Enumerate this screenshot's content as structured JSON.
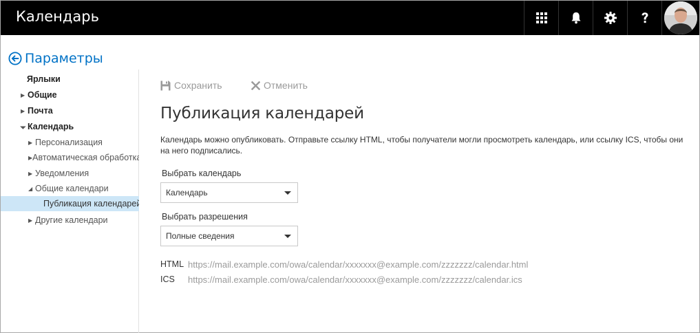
{
  "app": {
    "title": "Календарь"
  },
  "header": {
    "back_title": "Параметры"
  },
  "sidebar": {
    "items": [
      {
        "label": "Ярлыки",
        "level": 1,
        "caret": ""
      },
      {
        "label": "Общие",
        "level": 1,
        "caret": "right"
      },
      {
        "label": "Почта",
        "level": 1,
        "caret": "right"
      },
      {
        "label": "Календарь",
        "level": 1,
        "caret": "down"
      },
      {
        "label": "Персонализация",
        "level": 2,
        "caret": "right"
      },
      {
        "label": "Автоматическая обработка",
        "level": 2,
        "caret": "right"
      },
      {
        "label": "Уведомления",
        "level": 2,
        "caret": "right"
      },
      {
        "label": "Общие календари",
        "level": 2,
        "caret": "down"
      },
      {
        "label": "Публикация календарей",
        "level": 3,
        "caret": "",
        "selected": true
      },
      {
        "label": "Другие календари",
        "level": 2,
        "caret": "right"
      }
    ]
  },
  "toolbar": {
    "save_label": "Сохранить",
    "cancel_label": "Отменить"
  },
  "main": {
    "title": "Публикация календарей",
    "description": "Календарь можно опубликовать. Отправьте ссылку HTML, чтобы получатели могли просмотреть календарь, или ссылку ICS, чтобы они на него подписались.",
    "calendar_label": "Выбрать календарь",
    "calendar_value": "Календарь",
    "permission_label": "Выбрать разрешения",
    "permission_value": "Полные сведения",
    "html_key": "HTML",
    "html_url": "https://mail.example.com/owa/calendar/xxxxxxx@example.com/zzzzzzz/calendar.html",
    "ics_key": "ICS",
    "ics_url": "https://mail.example.com/owa/calendar/xxxxxxx@example.com/zzzzzzz/calendar.ics"
  },
  "colors": {
    "accent": "#0072c6",
    "topbar": "#000000",
    "selected": "#cde6f7"
  }
}
